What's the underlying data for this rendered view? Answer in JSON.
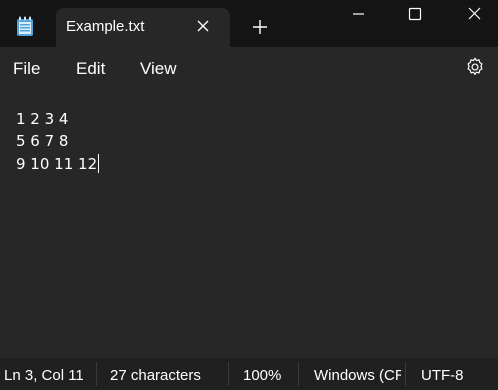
{
  "tab": {
    "title": "Example.txt"
  },
  "menu": {
    "file": "File",
    "edit": "Edit",
    "view": "View"
  },
  "editor": {
    "lines": [
      "1 2 3 4",
      "5 6 7 8",
      "9 10 11 12"
    ]
  },
  "status": {
    "position": "Ln 3, Col 11",
    "characters": "27 characters",
    "zoom": "100%",
    "line_ending": "Windows (CRLF)",
    "encoding": "UTF-8"
  },
  "icons": {
    "app": "notepad-icon",
    "tab_close": "close-icon",
    "new_tab": "plus-icon",
    "minimize": "minimize-icon",
    "maximize": "maximize-icon",
    "close": "close-window-icon",
    "settings": "gear-icon"
  },
  "colors": {
    "background": "#202020",
    "editor": "#272727",
    "titlebar": "#141414",
    "text": "#ffffff"
  }
}
